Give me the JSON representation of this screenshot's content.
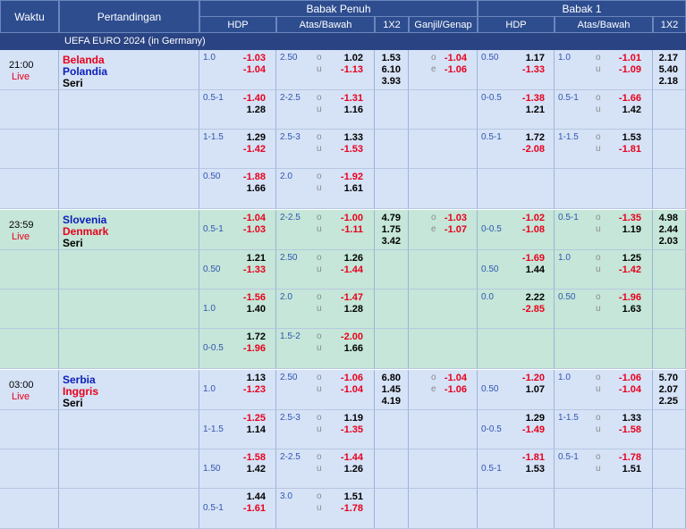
{
  "headers": {
    "waktu": "Waktu",
    "pertandingan": "Pertandingan",
    "babak_penuh": "Babak Penuh",
    "babak_1": "Babak 1",
    "hdp": "HDP",
    "atas_bawah": "Atas/Bawah",
    "x12": "1X2",
    "ganjil_genap": "Ganjil/Genap"
  },
  "league": "UEFA EURO 2024 (in Germany)",
  "colors": {
    "header": "#2d4d8f",
    "row_blue": "#d6e2f6",
    "row_green": "#c5e6d8",
    "negative": "#e8001c",
    "line": "#2f56b0"
  },
  "matches": [
    {
      "time": "21:00",
      "live": "Live",
      "home": "Belanda",
      "away": "Polandia",
      "draw": "Seri",
      "home_color": "red",
      "away_color": "blue",
      "rows": [
        {
          "fh_line": "1.0",
          "fh_home": "-1.03",
          "fh_away": "-1.04",
          "fh_line_pos": "top",
          "ou_line": "2.50",
          "o_lbl": "o",
          "u_lbl": "u",
          "o_val": "1.02",
          "u_val": "-1.13",
          "ou_line_pos": "top",
          "x1": "1.53",
          "x2": "6.10",
          "x3": "3.93",
          "odd_lbl": "o",
          "even_lbl": "e",
          "odd_val": "-1.04",
          "even_val": "-1.06",
          "h1_line": "0.50",
          "h1_home": "1.17",
          "h1_away": "-1.33",
          "h1_line_pos": "top",
          "h1ou_line": "1.0",
          "h1_o": "-1.01",
          "h1_u": "-1.09",
          "h1ou_line_pos": "top",
          "h1x1": "2.17",
          "h1x2": "5.40",
          "h1x3": "2.18"
        },
        {
          "fh_line": "0.5-1",
          "fh_home": "-1.40",
          "fh_away": "1.28",
          "fh_line_pos": "top",
          "ou_line": "2-2.5",
          "o_lbl": "o",
          "u_lbl": "u",
          "o_val": "-1.31",
          "u_val": "1.16",
          "ou_line_pos": "top",
          "h1_line": "0-0.5",
          "h1_home": "-1.38",
          "h1_away": "1.21",
          "h1_line_pos": "top",
          "h1ou_line": "0.5-1",
          "h1_o": "-1.66",
          "h1_u": "1.42",
          "h1ou_line_pos": "top"
        },
        {
          "fh_line": "1-1.5",
          "fh_home": "1.29",
          "fh_away": "-1.42",
          "fh_line_pos": "top",
          "ou_line": "2.5-3",
          "o_lbl": "o",
          "u_lbl": "u",
          "o_val": "1.33",
          "u_val": "-1.53",
          "ou_line_pos": "top",
          "h1_line": "0.5-1",
          "h1_home": "1.72",
          "h1_away": "-2.08",
          "h1_line_pos": "top",
          "h1ou_line": "1-1.5",
          "h1_o": "1.53",
          "h1_u": "-1.81",
          "h1ou_line_pos": "top"
        },
        {
          "fh_line": "0.50",
          "fh_home": "-1.88",
          "fh_away": "1.66",
          "fh_line_pos": "top",
          "ou_line": "2.0",
          "o_lbl": "o",
          "u_lbl": "u",
          "o_val": "-1.92",
          "u_val": "1.61",
          "ou_line_pos": "top"
        }
      ]
    },
    {
      "time": "23:59",
      "live": "Live",
      "home": "Slovenia",
      "away": "Denmark",
      "draw": "Seri",
      "home_color": "blue",
      "away_color": "red",
      "rows": [
        {
          "fh_line": "0.5-1",
          "fh_home": "-1.04",
          "fh_away": "-1.03",
          "fh_line_pos": "bottom",
          "ou_line": "2-2.5",
          "o_lbl": "o",
          "u_lbl": "u",
          "o_val": "-1.00",
          "u_val": "-1.11",
          "ou_line_pos": "top",
          "x1": "4.79",
          "x2": "1.75",
          "x3": "3.42",
          "odd_lbl": "o",
          "even_lbl": "e",
          "odd_val": "-1.03",
          "even_val": "-1.07",
          "h1_line": "0-0.5",
          "h1_home": "-1.02",
          "h1_away": "-1.08",
          "h1_line_pos": "bottom",
          "h1ou_line": "0.5-1",
          "h1_o": "-1.35",
          "h1_u": "1.19",
          "h1ou_line_pos": "top",
          "h1x1": "4.98",
          "h1x2": "2.44",
          "h1x3": "2.03"
        },
        {
          "fh_line": "0.50",
          "fh_home": "1.21",
          "fh_away": "-1.33",
          "fh_line_pos": "bottom",
          "ou_line": "2.50",
          "o_lbl": "o",
          "u_lbl": "u",
          "o_val": "1.26",
          "u_val": "-1.44",
          "ou_line_pos": "top",
          "h1_line": "0.50",
          "h1_home": "-1.69",
          "h1_away": "1.44",
          "h1_line_pos": "bottom",
          "h1ou_line": "1.0",
          "h1_o": "1.25",
          "h1_u": "-1.42",
          "h1ou_line_pos": "top"
        },
        {
          "fh_line": "1.0",
          "fh_home": "-1.56",
          "fh_away": "1.40",
          "fh_line_pos": "bottom",
          "ou_line": "2.0",
          "o_lbl": "o",
          "u_lbl": "u",
          "o_val": "-1.47",
          "u_val": "1.28",
          "ou_line_pos": "top",
          "h1_line": "0.0",
          "h1_home": "2.22",
          "h1_away": "-2.85",
          "h1_line_pos": "top",
          "h1ou_line": "0.50",
          "h1_o": "-1.96",
          "h1_u": "1.63",
          "h1ou_line_pos": "top"
        },
        {
          "fh_line": "0-0.5",
          "fh_home": "1.72",
          "fh_away": "-1.96",
          "fh_line_pos": "bottom",
          "ou_line": "1.5-2",
          "o_lbl": "o",
          "u_lbl": "u",
          "o_val": "-2.00",
          "u_val": "1.66",
          "ou_line_pos": "top"
        }
      ]
    },
    {
      "time": "03:00",
      "live": "Live",
      "home": "Serbia",
      "away": "Inggris",
      "draw": "Seri",
      "home_color": "blue",
      "away_color": "red",
      "rows": [
        {
          "fh_line": "1.0",
          "fh_home": "1.13",
          "fh_away": "-1.23",
          "fh_line_pos": "bottom",
          "ou_line": "2.50",
          "o_lbl": "o",
          "u_lbl": "u",
          "o_val": "-1.06",
          "u_val": "-1.04",
          "ou_line_pos": "top",
          "x1": "6.80",
          "x2": "1.45",
          "x3": "4.19",
          "odd_lbl": "o",
          "even_lbl": "e",
          "odd_val": "-1.04",
          "even_val": "-1.06",
          "h1_line": "0.50",
          "h1_home": "-1.20",
          "h1_away": "1.07",
          "h1_line_pos": "bottom",
          "h1ou_line": "1.0",
          "h1_o": "-1.06",
          "h1_u": "-1.04",
          "h1ou_line_pos": "top",
          "h1x1": "5.70",
          "h1x2": "2.07",
          "h1x3": "2.25"
        },
        {
          "fh_line": "1-1.5",
          "fh_home": "-1.25",
          "fh_away": "1.14",
          "fh_line_pos": "bottom",
          "ou_line": "2.5-3",
          "o_lbl": "o",
          "u_lbl": "u",
          "o_val": "1.19",
          "u_val": "-1.35",
          "ou_line_pos": "top",
          "h1_line": "0-0.5",
          "h1_home": "1.29",
          "h1_away": "-1.49",
          "h1_line_pos": "bottom",
          "h1ou_line": "1-1.5",
          "h1_o": "1.33",
          "h1_u": "-1.58",
          "h1ou_line_pos": "top"
        },
        {
          "fh_line": "1.50",
          "fh_home": "-1.58",
          "fh_away": "1.42",
          "fh_line_pos": "bottom",
          "ou_line": "2-2.5",
          "o_lbl": "o",
          "u_lbl": "u",
          "o_val": "-1.44",
          "u_val": "1.26",
          "ou_line_pos": "top",
          "h1_line": "0.5-1",
          "h1_home": "-1.81",
          "h1_away": "1.53",
          "h1_line_pos": "bottom",
          "h1ou_line": "0.5-1",
          "h1_o": "-1.78",
          "h1_u": "1.51",
          "h1ou_line_pos": "top"
        },
        {
          "fh_line": "0.5-1",
          "fh_home": "1.44",
          "fh_away": "-1.61",
          "fh_line_pos": "bottom",
          "ou_line": "3.0",
          "o_lbl": "o",
          "u_lbl": "u",
          "o_val": "1.51",
          "u_val": "-1.78",
          "ou_line_pos": "top"
        }
      ]
    }
  ]
}
